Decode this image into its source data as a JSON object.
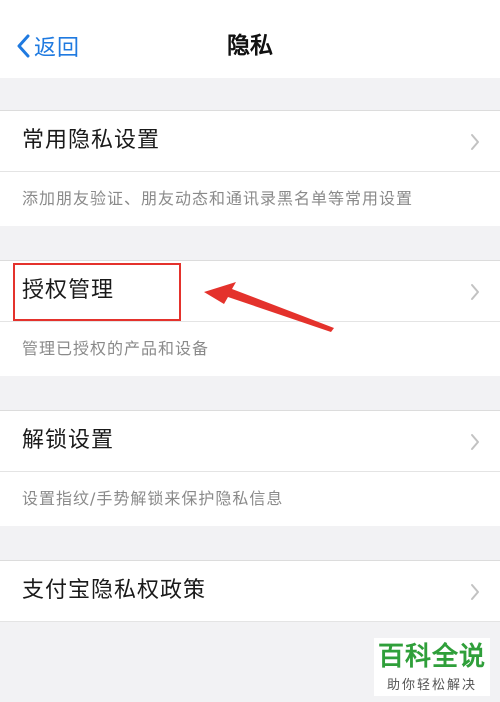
{
  "header": {
    "back_label": "返回",
    "title": "隐私"
  },
  "sections": [
    {
      "label": "常用隐私设置",
      "description": "添加朋友验证、朋友动态和通讯录黑名单等常用设置"
    },
    {
      "label": "授权管理",
      "description": "管理已授权的产品和设备"
    },
    {
      "label": "解锁设置",
      "description": "设置指纹/手势解锁来保护隐私信息"
    },
    {
      "label": "支付宝隐私权政策",
      "description": ""
    }
  ],
  "watermark": {
    "title": "百科全说",
    "subtitle": "助你轻松解决"
  },
  "colors": {
    "accent": "#1f7ae0",
    "highlight": "#e4322c",
    "watermark": "#2f9f3a"
  },
  "icons": {
    "back": "chevron-left-icon",
    "row": "chevron-right-icon",
    "annotation": "arrow-icon"
  }
}
